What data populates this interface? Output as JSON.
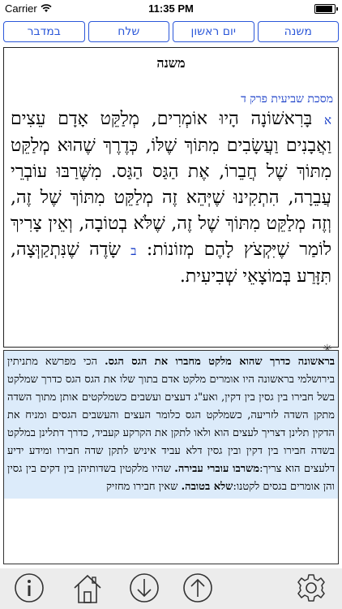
{
  "status": {
    "carrier": "Carrier",
    "time": "11:35 PM"
  },
  "tabs": [
    {
      "label": "במדבר"
    },
    {
      "label": "שלח"
    },
    {
      "label": "יום ראשון"
    },
    {
      "label": "משנה"
    }
  ],
  "panel": {
    "title": "משנה",
    "section_heading": "מסכת שביעית פרק ד",
    "num_1": "א",
    "text_1": "בָּרִאשׁוֹנָה הָיוּ אוֹמְרִים, מְלַקֵּט אָדָם עֵצִים וַאֲבָנִים וַעֲשָׂבִים מִתּוֹךְ שֶׁלּוֹ, כְּדֶרֶךְ שֶׁהוּא מְלַקֵּט מִתּוֹךְ שֶׁל חֲבֵרוֹ, אֶת הַגַּס הַגַּס. מִשֶּׁרַבּוּ עוֹבְרֵי עֲבֵרָה, הִתְקִינוּ שֶׁיְּהֵא זֶה מְלַקֵּט מִתּוֹךְ שֶׁל זֶה, וְזֶה מְלַקֵּט מִתּוֹךְ שֶׁל זֶה, שֶׁלֹּא בְטוֹבָה, וְאֵין צָרִיךְ לוֹמַר שֶׁיִּקְצֹץ לָהֶם מְזוֹנוֹת:",
    "num_2": "ב",
    "text_2": "שָׂדֶה שֶׁנִּתְקַוְּצָה, תִּזָּרַע בְּמוֹצָאֵי שְׁבִיעִית."
  },
  "commentary": {
    "lead_bold": "בראשונה כדרך שהוא מלקט מחברו את הגס הגס.",
    "body_1": " הכי מפרשא מתניתין בירושלמי בראשונה היו אומרים מלקט אדם בתוך שלו את הגס הגס כדרך שמלקט בשל חבירו בין גסין בין דקין, ואע\"ג דעצים ועשבים כשמלקטים אותן מתוך השדה מתקן השדה לזריעה, כשמלקט הגס כלומר העצים והעשבים הגסים ומניח את הדקין תלינן דצריך לעצים הוא ולאו לתקן את הקרקע קעביד, כדרך דתלינן במלקט בשדה חבירו בין דקין ובין גסין דלא עביד איניש לתקן שדה חבירו ומידע ידיע דלעצים הוא צריך:",
    "bold_2": "משרבו עוברי עבירה.",
    "body_2": " שהיו מלקטין בשדותיהן בין דקים בין גסין והן אומרים בגסים לקטנו:",
    "bold_3": "שלא בטובה.",
    "body_3": " שאין חבירו מחזיק"
  },
  "toolbar": {
    "icons": [
      "settings-icon",
      "arrow-up-icon",
      "arrow-down-icon",
      "home-icon",
      "info-icon"
    ]
  },
  "colors": {
    "accent": "#2b57d9",
    "highlight": "#dcebfa"
  }
}
